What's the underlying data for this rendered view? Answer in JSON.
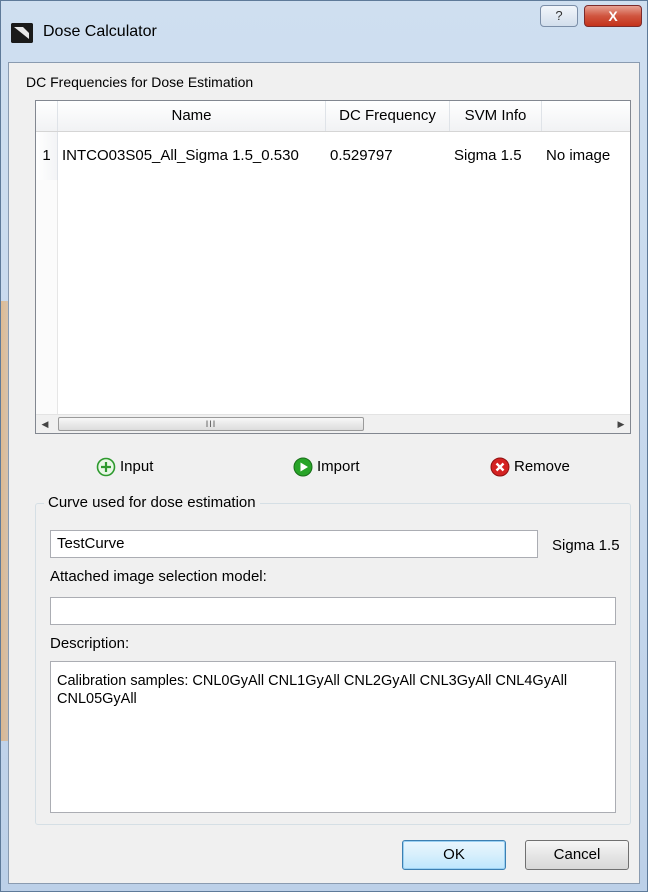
{
  "window": {
    "title": "Dose Calculator",
    "help_label": "?",
    "close_label": "X"
  },
  "frequencies": {
    "section_label": "DC Frequencies for Dose Estimation",
    "columns": [
      "Name",
      "DC Frequency",
      "SVM Info",
      ""
    ],
    "rows": [
      {
        "index": "1",
        "name": "INTCO03S05_All_Sigma 1.5_0.530",
        "dc_frequency": "0.529797",
        "svm_info": "Sigma 1.5",
        "extra": "No image"
      }
    ],
    "scroll_thumb_label": "III"
  },
  "actions": {
    "input_label": "Input",
    "import_label": "Import",
    "remove_label": "Remove"
  },
  "curve": {
    "group_title": "Curve used for dose estimation",
    "curve_name": "TestCurve",
    "sigma_label": "Sigma 1.5",
    "model_label": "Attached image selection model:",
    "model_value": "",
    "description_label": "Description:",
    "description_line1": "Calibration samples: CNL0GyAll CNL1GyAll CNL2GyAll CNL3GyAll CNL4GyAll",
    "description_line2": "CNL05GyAll"
  },
  "buttons": {
    "ok_label": "OK",
    "cancel_label": "Cancel"
  },
  "colors": {
    "input_icon": "#2e9a2e",
    "import_icon": "#1f8f1f",
    "remove_icon": "#d42222"
  }
}
